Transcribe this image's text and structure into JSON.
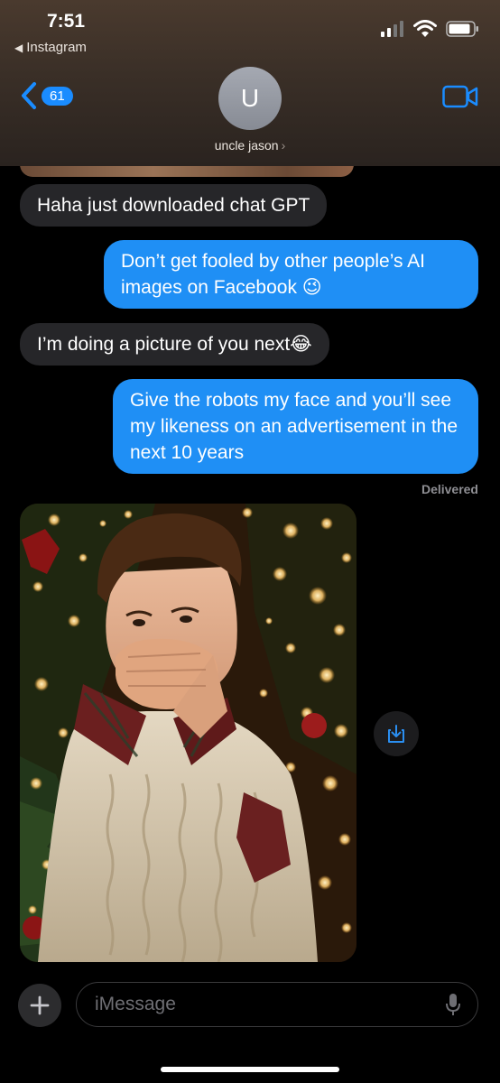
{
  "status_bar": {
    "time": "7:51",
    "back_app": "Instagram"
  },
  "nav": {
    "unread_count": "61",
    "avatar_initial": "U",
    "contact_name": "uncle jason"
  },
  "messages": [
    {
      "direction": "received",
      "text": "Haha just downloaded chat GPT"
    },
    {
      "direction": "sent",
      "text": "Don’t get fooled by other people’s AI images on Facebook 😉"
    },
    {
      "direction": "received",
      "text": "I’m doing a picture of you next😂"
    },
    {
      "direction": "sent",
      "text": "Give the robots my face and you’ll see my likeness on an advertisement in the next 10 years"
    }
  ],
  "delivered_label": "Delivered",
  "composer": {
    "placeholder": "iMessage"
  },
  "colors": {
    "sent_bubble": "#1f8ff5",
    "received_bubble": "#262629",
    "accent": "#1a8cff"
  }
}
